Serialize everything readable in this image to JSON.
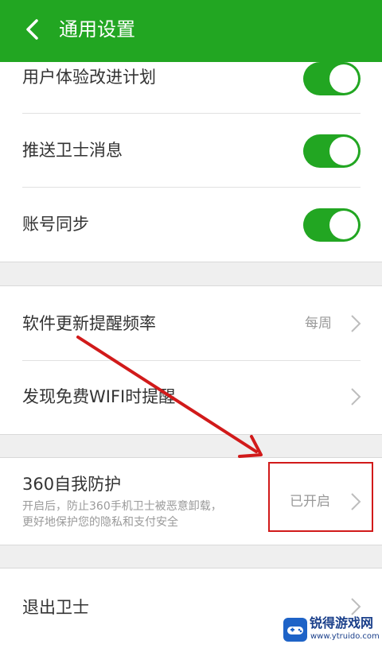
{
  "header": {
    "title": "通用设置"
  },
  "group1": {
    "rows": [
      {
        "label": "用户体验改进计划",
        "enabled": true
      },
      {
        "label": "推送卫士消息",
        "enabled": true
      },
      {
        "label": "账号同步",
        "enabled": true
      }
    ]
  },
  "group2": {
    "rows": [
      {
        "label": "软件更新提醒频率",
        "value": "每周"
      },
      {
        "label": "发现免费WIFI时提醒"
      }
    ]
  },
  "group3": {
    "row": {
      "label": "360自我防护",
      "sub_line1": "开启后，防止360手机卫士被恶意卸载，",
      "sub_line2": "更好地保护您的隐私和支付安全",
      "value": "已开启"
    }
  },
  "group4": {
    "row": {
      "label": "退出卫士"
    }
  },
  "watermark": {
    "text": "锐得游戏网",
    "url": "www.ytruido.com"
  },
  "colors": {
    "accent": "#22a622",
    "annotation": "#d11a1a"
  }
}
